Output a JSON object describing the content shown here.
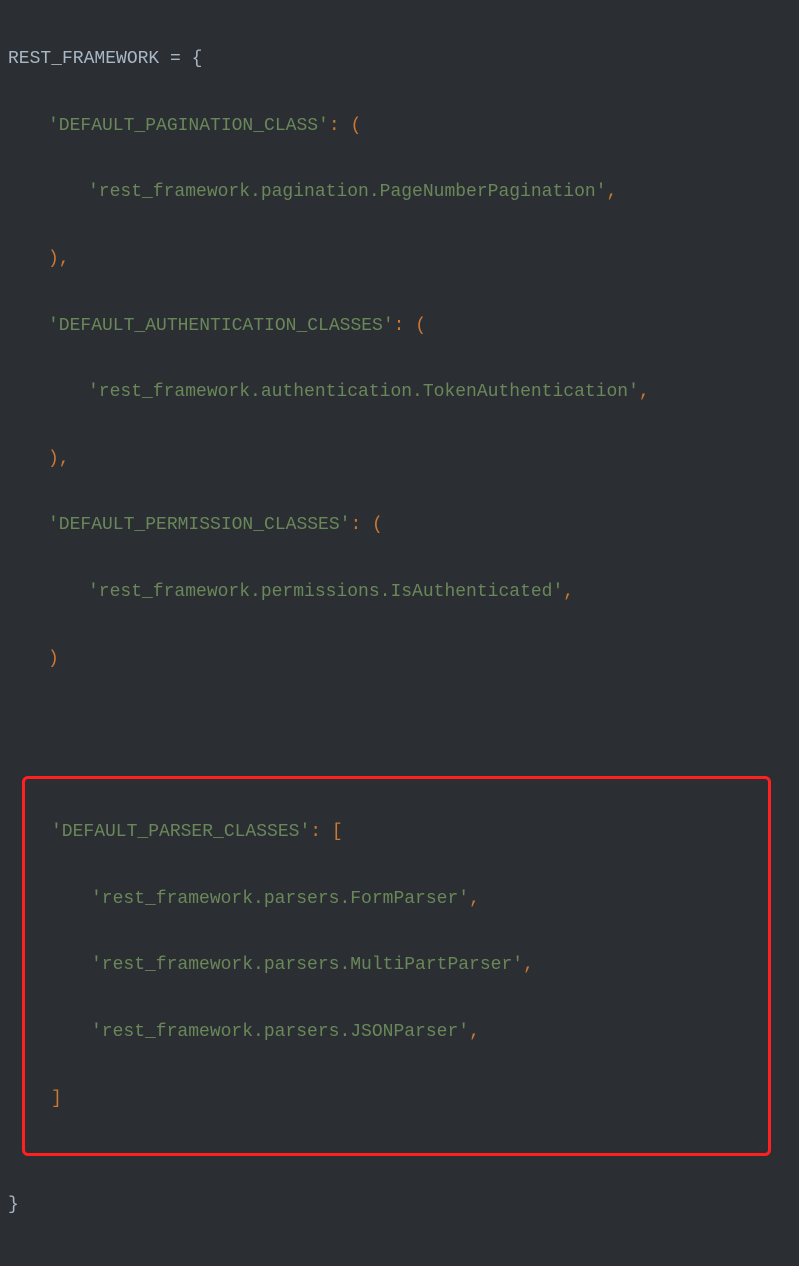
{
  "code": {
    "var_name": "REST_FRAMEWORK",
    "equals": " = ",
    "open_brace": "{",
    "close_brace": "}",
    "key1": "'DEFAULT_PAGINATION_CLASS'",
    "key1_open": ": (",
    "val1": "'rest_framework.pagination.PageNumberPagination'",
    "comma": ",",
    "close_paren": ")",
    "close_paren_comma": "),",
    "key2": "'DEFAULT_AUTHENTICATION_CLASSES'",
    "key2_open": ": (",
    "val2": "'rest_framework.authentication.TokenAuthentication'",
    "key3": "'DEFAULT_PERMISSION_CLASSES'",
    "key3_open": ": (",
    "val3": "'rest_framework.permissions.IsAuthenticated'",
    "key4": "'DEFAULT_PARSER_CLASSES'",
    "key4_open": ": [",
    "val4a": "'rest_framework.parsers.FormParser'",
    "val4b": "'rest_framework.parsers.MultiPartParser'",
    "val4c": "'rest_framework.parsers.JSONParser'",
    "close_bracket": "]"
  }
}
